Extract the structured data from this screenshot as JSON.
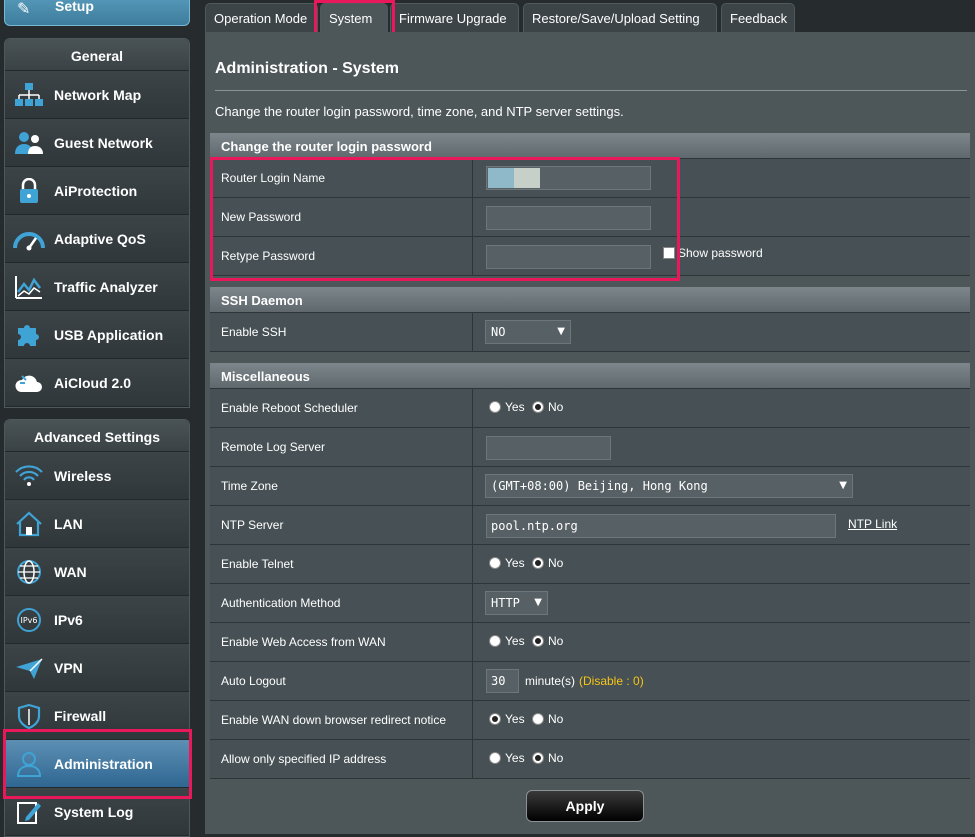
{
  "sidebar": {
    "setup_label": "Setup",
    "general": {
      "heading": "General",
      "items": [
        {
          "label": "Network Map"
        },
        {
          "label": "Guest Network"
        },
        {
          "label": "AiProtection"
        },
        {
          "label": "Adaptive QoS"
        },
        {
          "label": "Traffic Analyzer"
        },
        {
          "label": "USB Application"
        },
        {
          "label": "AiCloud 2.0"
        }
      ]
    },
    "advanced": {
      "heading": "Advanced Settings",
      "items": [
        {
          "label": "Wireless"
        },
        {
          "label": "LAN"
        },
        {
          "label": "WAN"
        },
        {
          "label": "IPv6"
        },
        {
          "label": "VPN"
        },
        {
          "label": "Firewall"
        },
        {
          "label": "Administration"
        },
        {
          "label": "System Log"
        }
      ]
    }
  },
  "tabs": [
    "Operation Mode",
    "System",
    "Firmware Upgrade",
    "Restore/Save/Upload Setting",
    "Feedback"
  ],
  "page": {
    "title": "Administration - System",
    "description": "Change the router login password, time zone, and NTP server settings."
  },
  "login_section": {
    "heading": "Change the router login password",
    "login_name_label": "Router Login Name",
    "new_password_label": "New Password",
    "retype_password_label": "Retype Password",
    "show_password_label": "Show password"
  },
  "ssh_section": {
    "heading": "SSH Daemon",
    "enable_ssh_label": "Enable SSH",
    "enable_ssh_value": "NO"
  },
  "misc_section": {
    "heading": "Miscellaneous",
    "reboot_label": "Enable Reboot Scheduler",
    "remote_log_label": "Remote Log Server",
    "time_zone_label": "Time Zone",
    "time_zone_value": "(GMT+08:00) Beijing, Hong Kong",
    "ntp_label": "NTP Server",
    "ntp_value": "pool.ntp.org",
    "ntp_link": "NTP Link",
    "telnet_label": "Enable Telnet",
    "auth_label": "Authentication Method",
    "auth_value": "HTTP",
    "wan_access_label": "Enable Web Access from WAN",
    "auto_logout_label": "Auto Logout",
    "auto_logout_value": "30",
    "auto_logout_unit": "minute(s)",
    "auto_logout_hint": "(Disable : 0)",
    "wan_redirect_label": "Enable WAN down browser redirect notice",
    "allow_ip_label": "Allow only specified IP address"
  },
  "radio": {
    "yes": "Yes",
    "no": "No"
  },
  "apply_label": "Apply",
  "colors": {
    "highlight": "#e8185a",
    "hint": "#f5c518"
  }
}
